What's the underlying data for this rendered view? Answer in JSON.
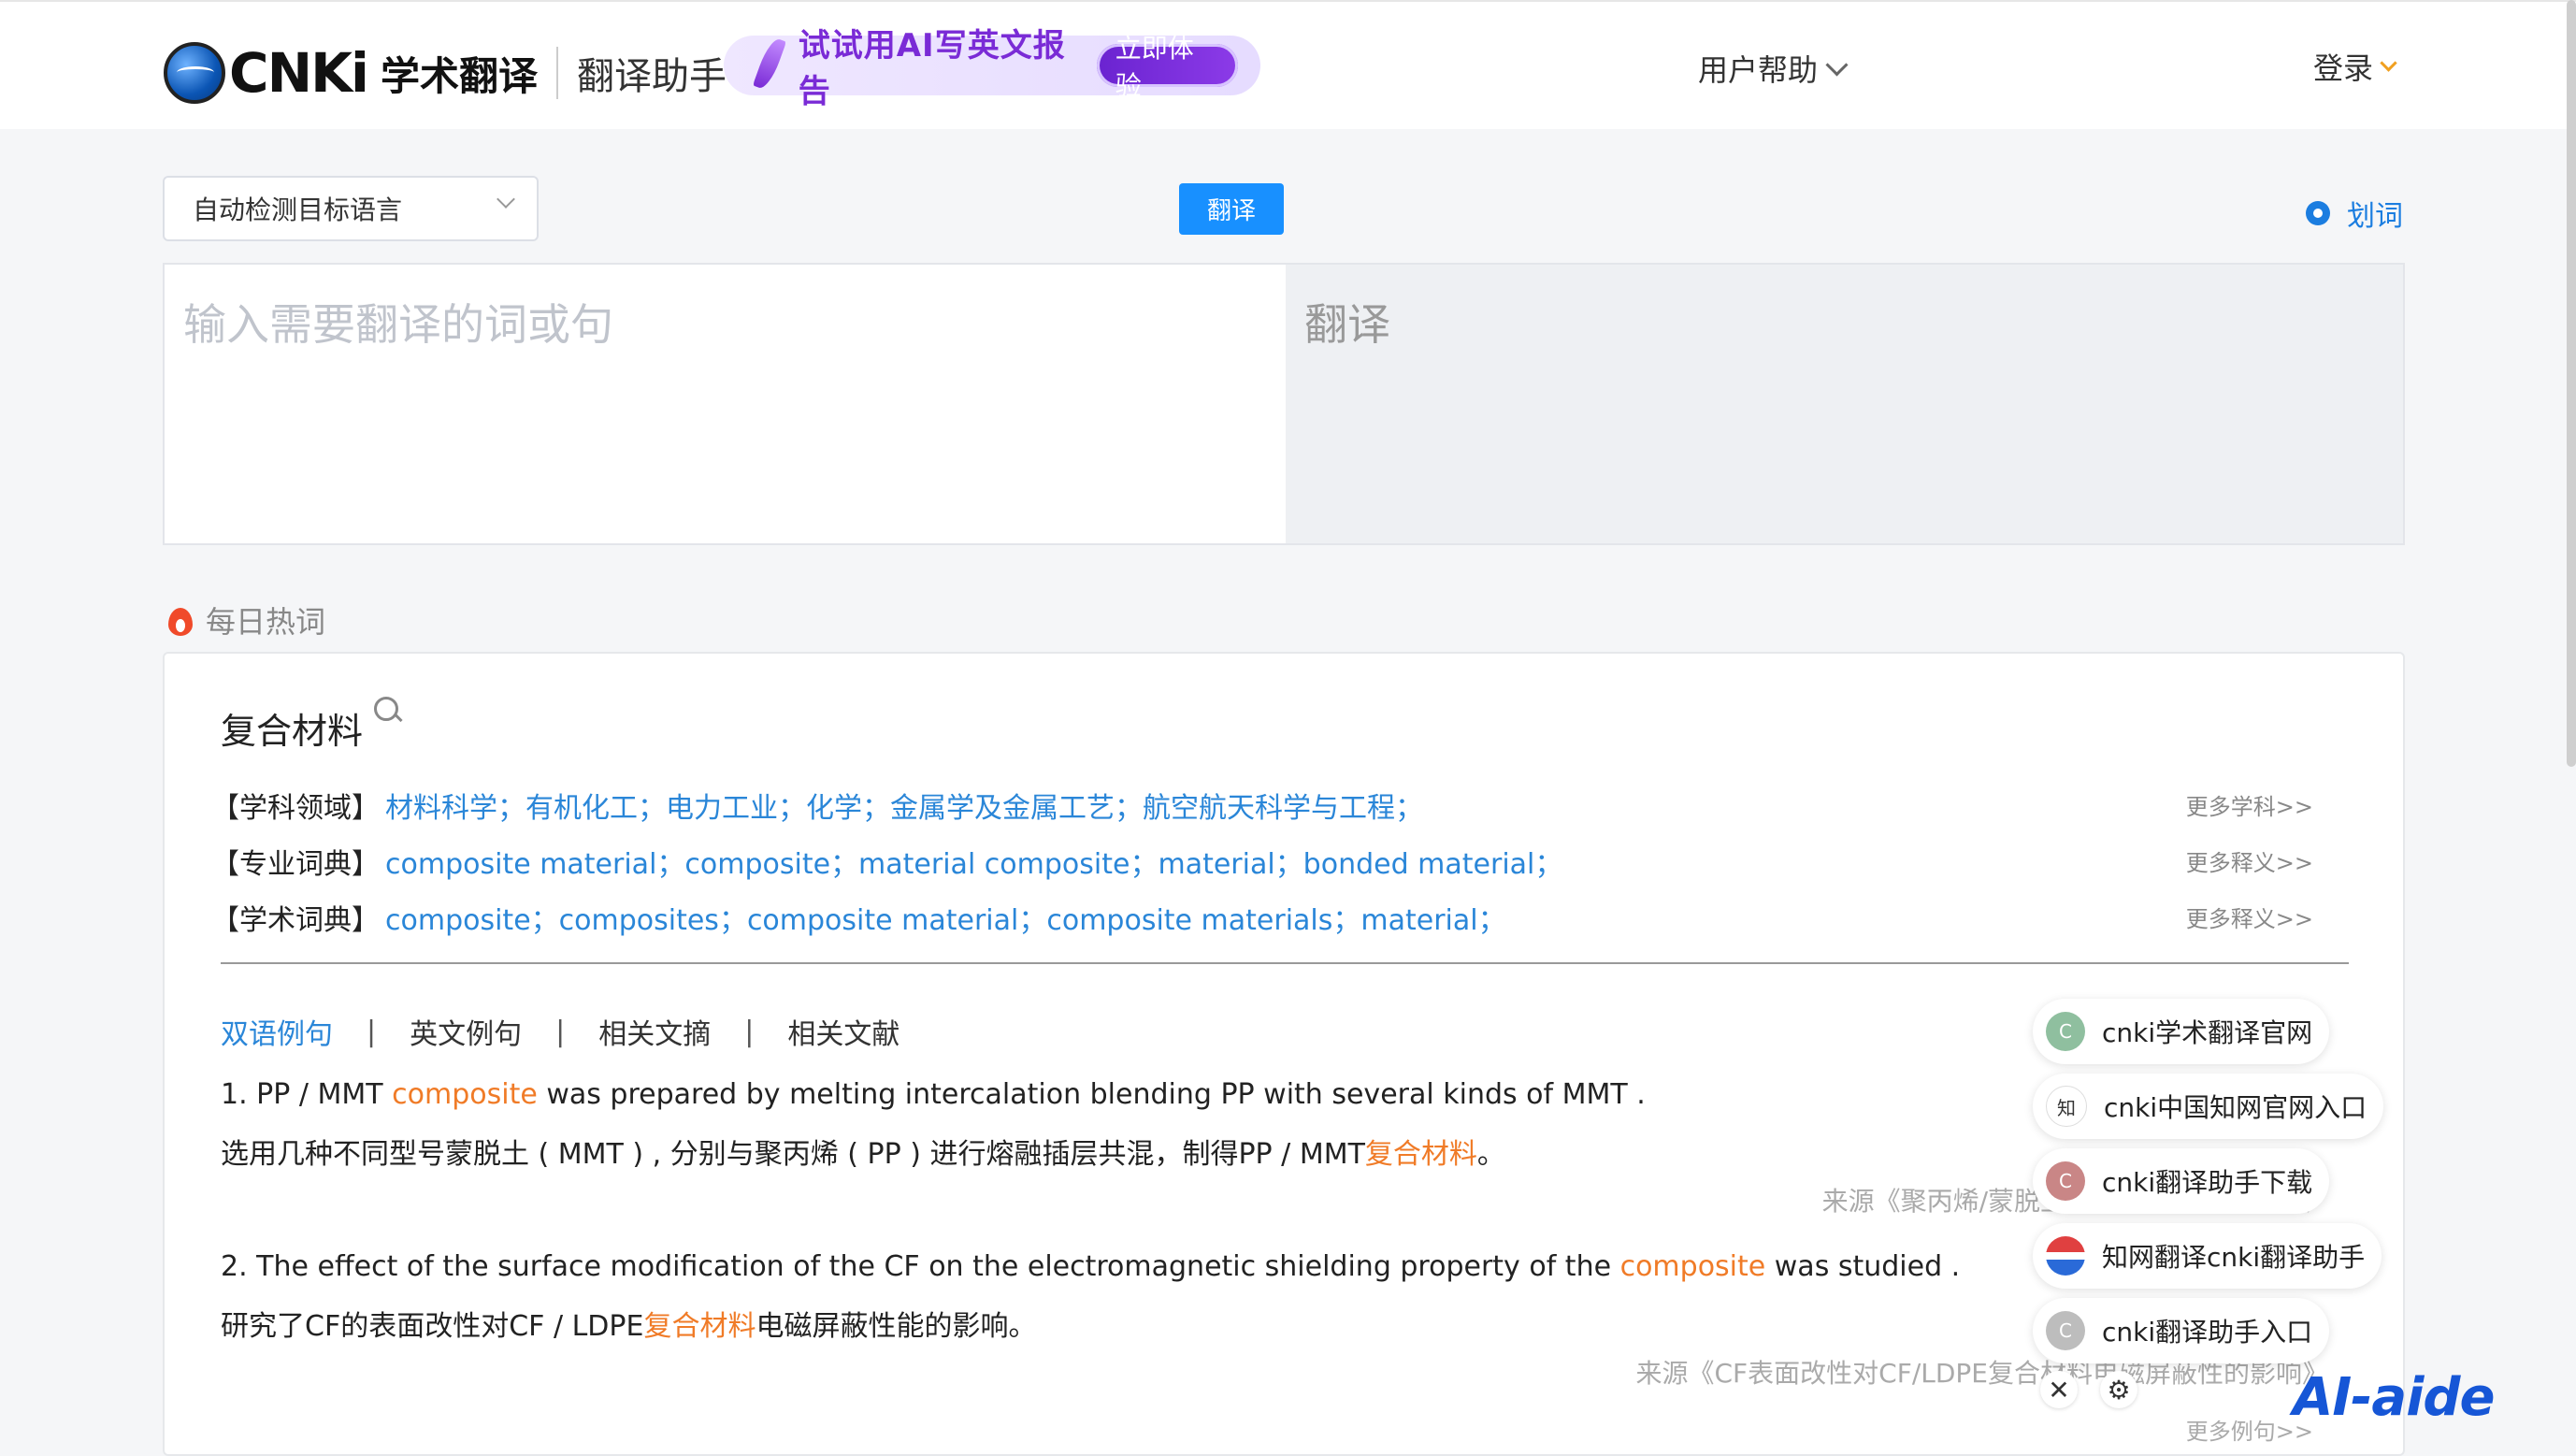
{
  "header": {
    "logo_text": "CNKi",
    "logo_sub": "学术翻译",
    "assistant": "翻译助手",
    "banner_text": "试试用AI写英文报告",
    "banner_button": "立即体验",
    "help_label": "用户帮助",
    "login_label": "登录"
  },
  "toolbar": {
    "language_select": "自动检测目标语言",
    "translate_button": "翻译",
    "huaci_label": "划词"
  },
  "editor": {
    "input_placeholder": "输入需要翻译的词或句",
    "output_placeholder": "翻译"
  },
  "hot": {
    "title": "每日热词",
    "word": "复合材料",
    "dict_rows": [
      {
        "label": "【学科领域】",
        "items": "材料科学；有机化工；电力工业；化学；金属学及金属工艺；航空航天科学与工程；",
        "more": "更多学科>>"
      },
      {
        "label": "【专业词典】",
        "items": "composite material；composite；material composite；material；bonded material；",
        "more": "更多释义>>"
      },
      {
        "label": "【学术词典】",
        "items": "composite；composites；composite material；composite materials；material；",
        "more": "更多释义>>"
      }
    ],
    "tabs": [
      "双语例句",
      "英文例句",
      "相关文摘",
      "相关文献"
    ],
    "examples": [
      {
        "en_pre": "1. PP / MMT ",
        "en_hl": "composite",
        "en_post": " was prepared by melting intercalation blending PP with several kinds of MMT .",
        "zh_pre": "选用几种不同型号蒙脱土 ( MMT ) , 分别与聚丙烯 ( PP ) 进行熔融插层共混，制得PP / MMT",
        "zh_hl": "复合材料",
        "zh_post": "。",
        "source": "来源《聚丙烯/蒙脱土纳米复合材料的研究》"
      },
      {
        "en_pre": "2. The effect of the surface modification of the CF on the electromagnetic shielding property of the ",
        "en_hl": "composite",
        "en_post": " was studied .",
        "zh_pre": "研究了CF的表面改性对CF / LDPE",
        "zh_hl": "复合材料",
        "zh_post": "电磁屏蔽性能的影响。",
        "source": "来源《CF表面改性对CF/LDPE复合材料电磁屏蔽性的影响》"
      }
    ],
    "more_examples": "更多例句>>"
  },
  "float_links": [
    {
      "label": "cnki学术翻译官网",
      "icon": "C",
      "color": "#8fbf9f"
    },
    {
      "label": "cnki中国知网官网入口",
      "icon": "知",
      "color": "#ffffff"
    },
    {
      "label": "cnki翻译助手下载",
      "icon": "C",
      "color": "#c98686"
    },
    {
      "label": "知网翻译cnki翻译助手",
      "icon": "",
      "color": "#e04040"
    },
    {
      "label": "cnki翻译助手入口",
      "icon": "C",
      "color": "#bdbdbd"
    }
  ],
  "float_controls": {
    "close": "✕",
    "settings": "⚙"
  },
  "watermark": "AI-aide"
}
